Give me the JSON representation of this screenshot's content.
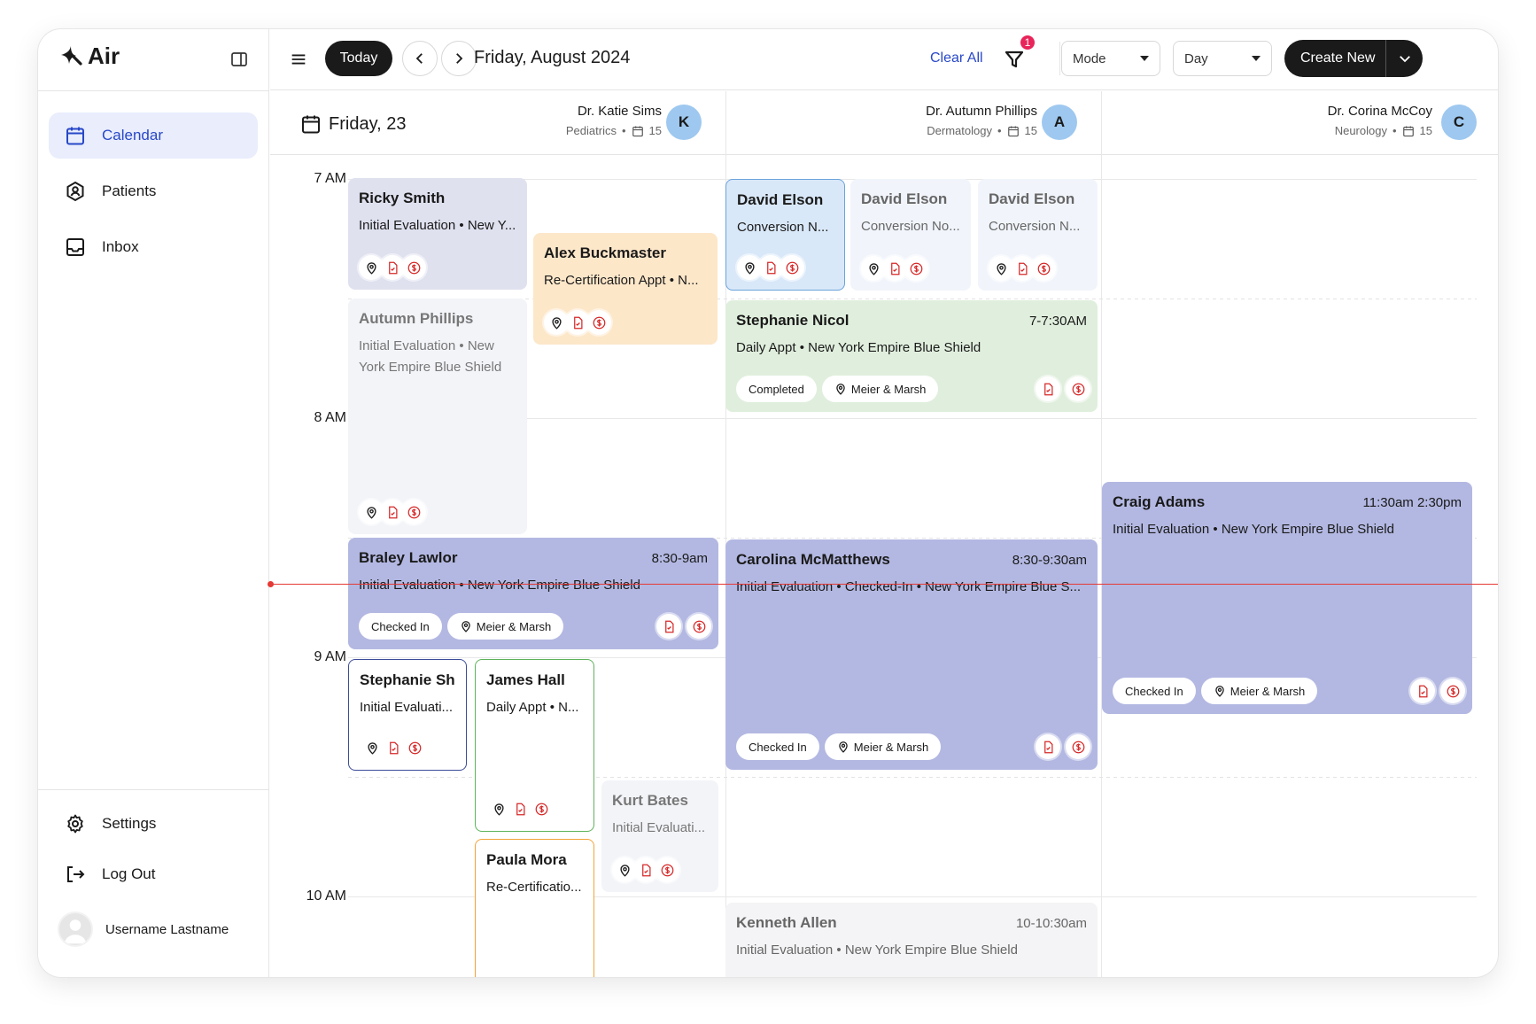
{
  "app": {
    "brand": "Air"
  },
  "sidebar": {
    "nav": [
      {
        "label": "Calendar",
        "icon": "calendar-icon",
        "active": true
      },
      {
        "label": "Patients",
        "icon": "patient-badge-icon"
      },
      {
        "label": "Inbox",
        "icon": "inbox-icon"
      }
    ],
    "settings_label": "Settings",
    "logout_label": "Log Out",
    "user_name": "Username Lastname"
  },
  "toolbar": {
    "today_label": "Today",
    "date_title": "Friday, August 2024",
    "clear_all": "Clear All",
    "filter_count": "1",
    "mode_label": "Mode",
    "view_label": "Day",
    "create_label": "Create New"
  },
  "day_header": {
    "label": "Friday, 23"
  },
  "doctors": [
    {
      "name": "Dr. Katie Sims",
      "specialty": "Pediatrics",
      "count": "15",
      "initial": "K"
    },
    {
      "name": "Dr. Autumn Phillips",
      "specialty": "Dermatology",
      "count": "15",
      "initial": "A"
    },
    {
      "name": "Dr. Corina McCoy",
      "specialty": "Neurology",
      "count": "15",
      "initial": "C"
    }
  ],
  "hours": [
    "7 AM",
    "8 AM",
    "9 AM",
    "10 AM"
  ],
  "events": {
    "ricky": {
      "name": "Ricky Smith",
      "desc": "Initial Evaluation • New Y..."
    },
    "alex": {
      "name": "Alex Buckmaster",
      "desc": "Re-Certification Appt • N..."
    },
    "autumn": {
      "name": "Autumn Phillips",
      "desc": "Initial Evaluation • New York Empire Blue Shield"
    },
    "david1": {
      "name": "David Elson",
      "desc": "Conversion N..."
    },
    "david2": {
      "name": "David Elson",
      "desc": "Conversion No..."
    },
    "david3": {
      "name": "David Elson",
      "desc": "Conversion N..."
    },
    "stephanie_n": {
      "name": "Stephanie Nicol",
      "time": "7-7:30AM",
      "desc": "Daily Appt • New York Empire Blue Shield",
      "status": "Completed",
      "location": "Meier & Marsh"
    },
    "braley": {
      "name": "Braley Lawlor",
      "time": "8:30-9am",
      "desc": "Initial Evaluation • New York Empire Blue Shield",
      "status": "Checked In",
      "location": "Meier & Marsh"
    },
    "carolina": {
      "name": "Carolina McMatthews",
      "time": "8:30-9:30am",
      "desc": "Initial Evaluation • Checked-In • New York Empire Blue S...",
      "status": "Checked In",
      "location": "Meier & Marsh"
    },
    "craig": {
      "name": "Craig Adams",
      "time": "11:30am 2:30pm",
      "desc": "Initial Evaluation • New York Empire Blue Shield",
      "status": "Checked In",
      "location": "Meier & Marsh"
    },
    "stephanie_s": {
      "name": "Stephanie Shar",
      "desc": "Initial Evaluati..."
    },
    "james": {
      "name": "James Hall",
      "desc": "Daily Appt • N..."
    },
    "kurt": {
      "name": "Kurt Bates",
      "desc": "Initial Evaluati..."
    },
    "paula": {
      "name": "Paula Mora",
      "desc": "Re-Certificatio..."
    },
    "kenneth": {
      "name": "Kenneth Allen",
      "time": "10-10:30am",
      "desc": "Initial Evaluation • New York Empire Blue Shield"
    }
  },
  "colors": {
    "accent": "#2848c8",
    "now_line": "#e53935",
    "badge": "#e8245a",
    "purple": "#b3b8e2",
    "peach": "#fde7c9",
    "green": "#e0efdd"
  }
}
